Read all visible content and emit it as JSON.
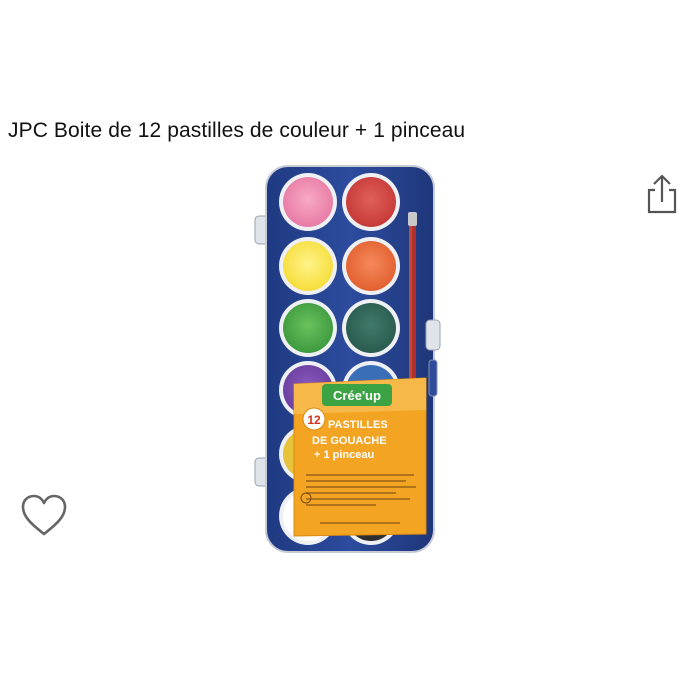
{
  "product": {
    "title": "JPC Boite de 12 pastilles de couleur + 1 pinceau"
  },
  "actions": {
    "share_icon": "share-icon",
    "favorite_icon": "heart-outline-icon"
  },
  "package_label": {
    "brand": "Crée'up",
    "count": "12",
    "line1": "PASTILLES",
    "line2": "DE GOUACHE",
    "line3": "+ 1 pinceau"
  },
  "colors": {
    "case_blue": "#2a4795",
    "label_orange": "#f3a423",
    "brush_red": "#b0302a"
  }
}
